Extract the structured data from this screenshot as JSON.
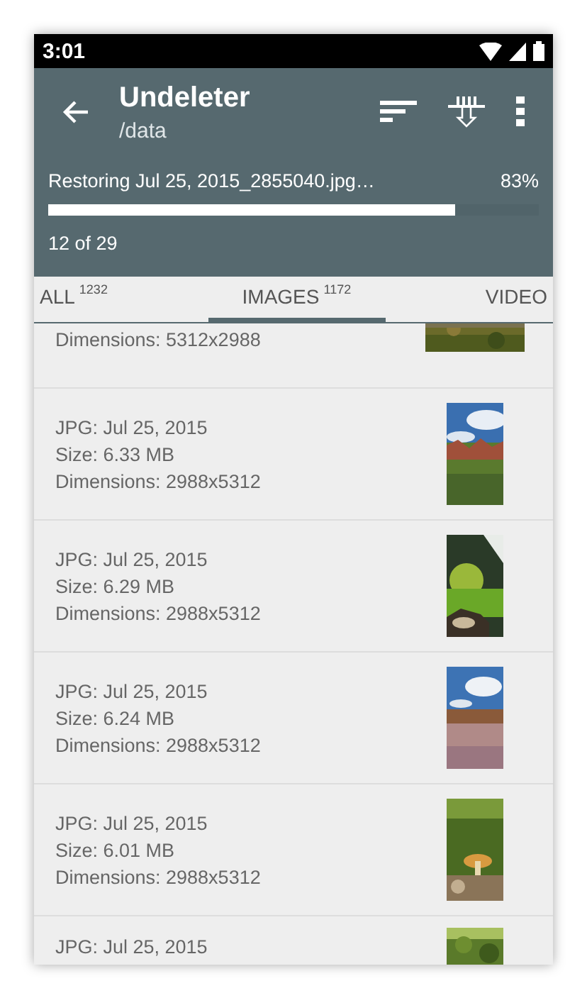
{
  "status_bar": {
    "time": "3:01"
  },
  "toolbar": {
    "title": "Undeleter",
    "subtitle": "/data"
  },
  "progress": {
    "message": "Restoring Jul 25, 2015_2855040.jpg…",
    "percent": "83%",
    "level": 0.83,
    "count": "12 of 29"
  },
  "tabs": [
    {
      "label": "ALL",
      "count": "1232",
      "selected": false
    },
    {
      "label": "IMAGES",
      "count": "1172",
      "selected": true
    },
    {
      "label": "VIDEO",
      "selected": false
    }
  ],
  "files": [
    {
      "dimensions": "Dimensions: 5312x2988",
      "kind": "picture"
    },
    {
      "type": "JPG: Jul 25, 2015",
      "size": "Size: 6.33 MB",
      "dimensions": "Dimensions: 2988x5312",
      "kind": "picture"
    },
    {
      "type": "JPG: Jul 25, 2015",
      "size": "Size: 6.29 MB",
      "dimensions": "Dimensions: 2988x5312",
      "kind": "picture"
    },
    {
      "type": "JPG: Jul 25, 2015",
      "size": "Size: 6.24 MB",
      "dimensions": "Dimensions: 2988x5312",
      "kind": "picture"
    },
    {
      "type": "JPG: Jul 25, 2015",
      "size": "Size: 6.01 MB",
      "dimensions": "Dimensions: 2988x5312",
      "kind": "picture"
    },
    {
      "type": "JPG: Jul 25, 2015",
      "kind": "picture"
    }
  ]
}
